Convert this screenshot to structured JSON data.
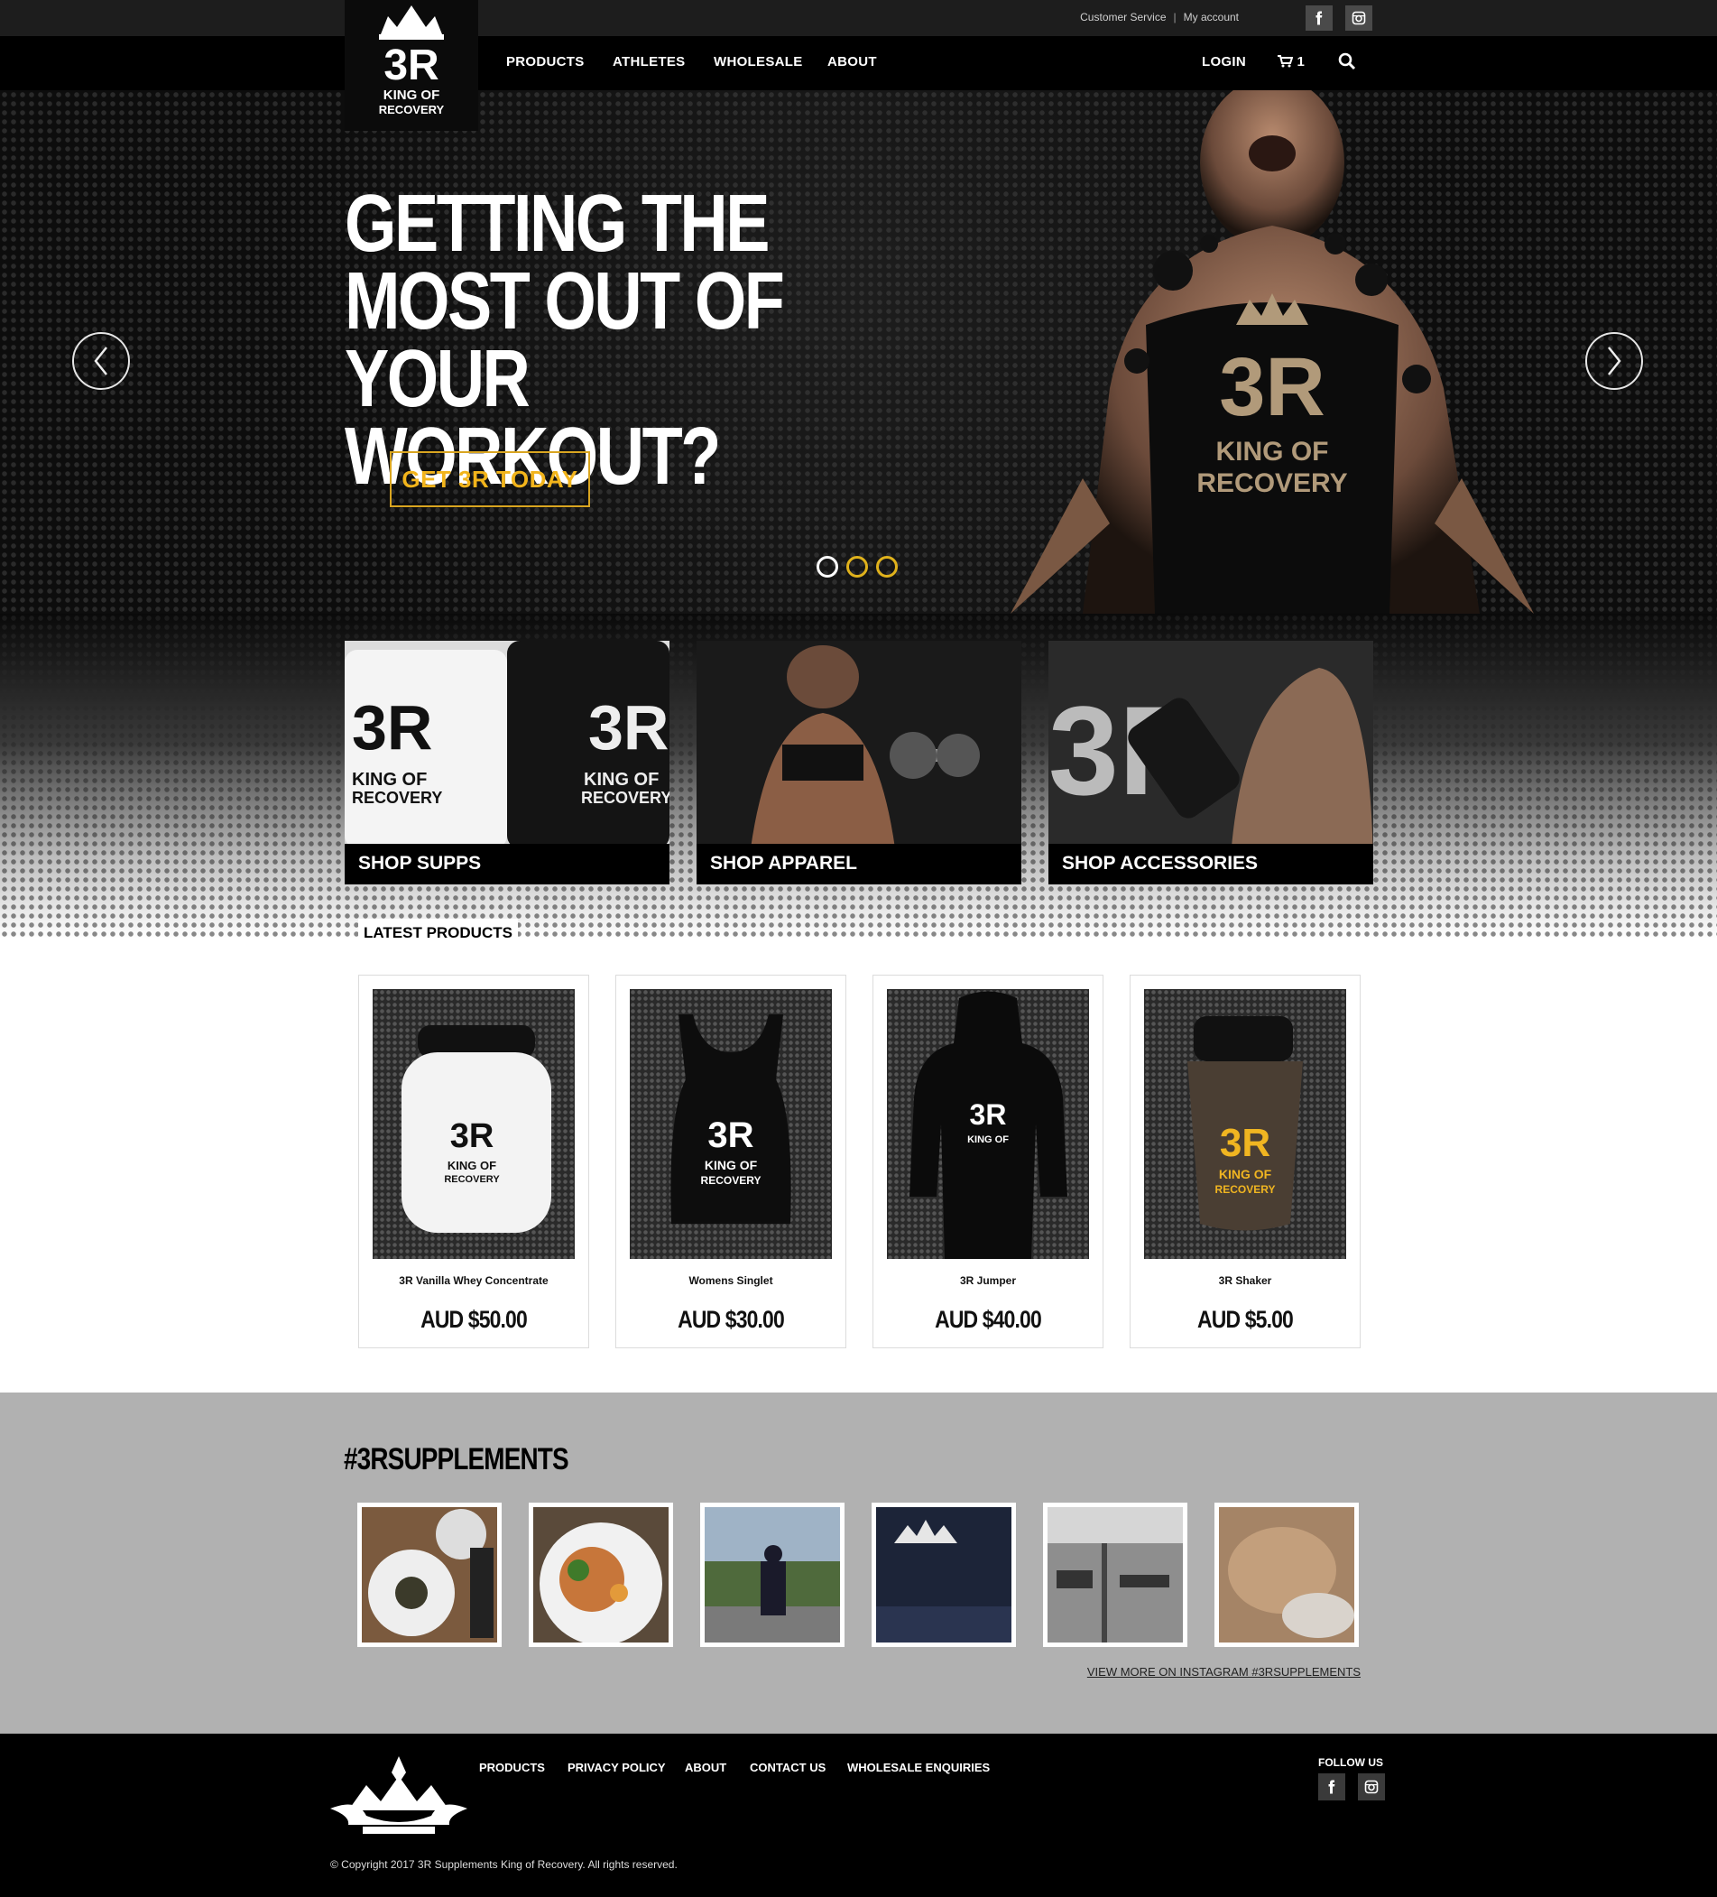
{
  "util": {
    "customer_service": "Customer Service",
    "separator": "|",
    "my_account": "My account"
  },
  "logo": {
    "mark": "3R",
    "line1": "KING OF",
    "line2": "RECOVERY"
  },
  "nav": {
    "items": [
      "PRODUCTS",
      "ATHLETES",
      "WHOLESALE",
      "ABOUT"
    ],
    "login": "LOGIN",
    "cart_count": "1"
  },
  "hero": {
    "lines": [
      "GETTING THE",
      "MOST OUT OF",
      "YOUR WORKOUT?"
    ],
    "cta": "GET 3R TODAY",
    "slides": 3,
    "active_slide": 1
  },
  "categories": [
    {
      "label": "SHOP SUPPS"
    },
    {
      "label": "SHOP APPAREL"
    },
    {
      "label": "SHOP ACCESSORIES"
    }
  ],
  "latest": {
    "heading": "LATEST PRODUCTS",
    "products": [
      {
        "name": "3R Vanilla Whey Concentrate",
        "price": "AUD $50.00"
      },
      {
        "name": "Womens Singlet",
        "price": "AUD $30.00"
      },
      {
        "name": "3R Jumper",
        "price": "AUD $40.00"
      },
      {
        "name": "3R Shaker",
        "price": "AUD $5.00"
      }
    ]
  },
  "instagram": {
    "heading": "#3RSUPPLEMENTS",
    "view_more": "VIEW MORE ON INSTAGRAM #3RSUPPLEMENTS"
  },
  "footer": {
    "links": [
      "PRODUCTS",
      "PRIVACY POLICY",
      "ABOUT",
      "CONTACT US",
      "WHOLESALE ENQUIRIES"
    ],
    "follow": "FOLLOW US",
    "copyright": "© Copyright 2017 3R Supplements King of Recovery. All rights reserved."
  },
  "colors": {
    "accent": "#e0b21c",
    "dark": "#000000",
    "insta_band": "#b1b1b1"
  }
}
